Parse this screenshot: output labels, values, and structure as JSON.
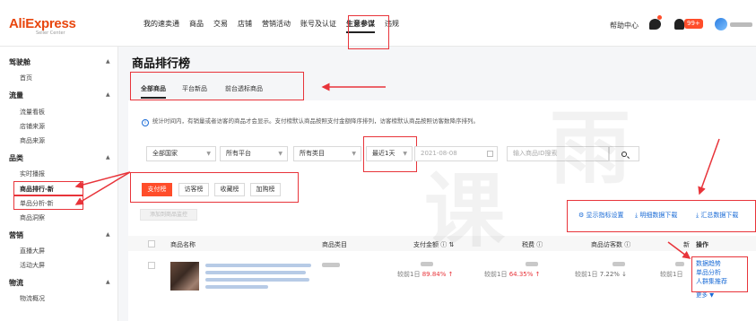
{
  "brand": {
    "name": "AliExpress",
    "sub": "Seller Center"
  },
  "nav": {
    "items": [
      "我的速卖通",
      "商品",
      "交易",
      "店铺",
      "营销活动",
      "账号及认证",
      "生意参谋",
      "违规"
    ],
    "active_index": 6,
    "help": "帮助中心",
    "badge": "99+"
  },
  "sidebar": {
    "sections": [
      {
        "title": "驾驶舱",
        "items": [
          "首页"
        ]
      },
      {
        "title": "流量",
        "items": [
          "流量看板",
          "店铺来源",
          "商品来源"
        ]
      },
      {
        "title": "品类",
        "items": [
          "实时播报",
          "商品排行-新",
          "单品分析-新",
          "商品洞察"
        ]
      },
      {
        "title": "营销",
        "items": [
          "直播大屏",
          "活动大屏"
        ]
      },
      {
        "title": "物流",
        "items": [
          "物流概况"
        ]
      }
    ]
  },
  "page": {
    "title": "商品排行榜",
    "tabs": [
      "全部商品",
      "平台新品",
      "前台透标商品"
    ],
    "active_tab": 0,
    "info": "统计时间内，有销量或者访客的商品才会显示。支付榜默认商品按照支付金额降序排列，访客榜默认商品按照访客数降序排列。"
  },
  "filters": {
    "country": "全部国家",
    "platform": "所有平台",
    "category": "所有类目",
    "period": "最近1天",
    "date": "2021-08-08",
    "search_placeholder": "输入商品ID搜索"
  },
  "rank_tabs": [
    "支付榜",
    "访客榜",
    "收藏榜",
    "加购榜"
  ],
  "add_button": "添加到商品监控",
  "tools": [
    "显示指标设置",
    "明细数据下载",
    "汇总数据下载"
  ],
  "table": {
    "headers": [
      "商品名称",
      "商品类目",
      "支付金额",
      "税费",
      "商品访客数",
      "新",
      "操作"
    ],
    "row": {
      "pay_prefix": "较前1日",
      "pay_pct": "89.84% ↑",
      "tax_prefix": "较前1日",
      "tax_pct": "64.35% ↑",
      "visitors_prefix": "较前1日",
      "visitors_pct": "7.22% ↓",
      "new_prefix": "较前1日",
      "actions": [
        "数据趋势",
        "单品分析",
        "人群集推荐"
      ],
      "more": "更多 ▼"
    }
  },
  "colors": {
    "accent": "#ff4d2a",
    "brand": "#e8460e",
    "link": "#1a6bd6",
    "annotation": "#e8343a"
  }
}
